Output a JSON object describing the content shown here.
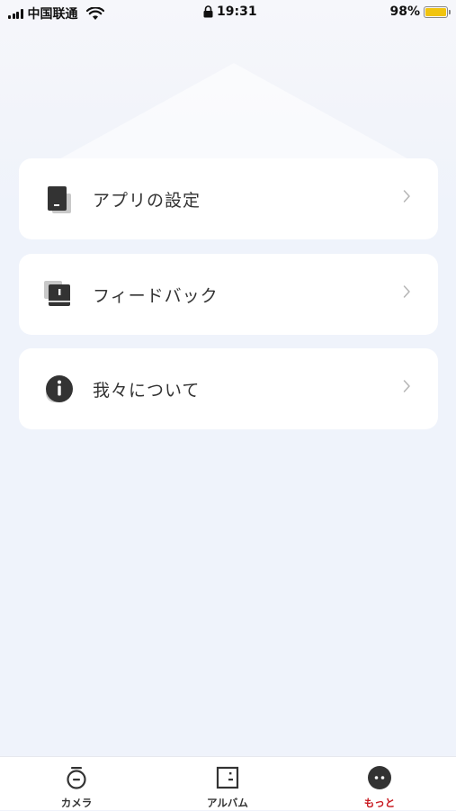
{
  "status_bar": {
    "carrier": "中国联通",
    "time": "19:31",
    "battery_percent": "98%",
    "battery_level": 0.98,
    "icons": [
      "signal-icon",
      "wifi-icon",
      "lock-icon",
      "battery-icon"
    ]
  },
  "menu": {
    "items": [
      {
        "label": "アプリの設定",
        "icon": "app-settings-icon",
        "chevron": "chevron-right-icon"
      },
      {
        "label": "フィードバック",
        "icon": "feedback-icon",
        "chevron": "chevron-right-icon"
      },
      {
        "label": "我々について",
        "icon": "info-icon",
        "chevron": "chevron-right-icon"
      }
    ]
  },
  "tab_bar": {
    "tabs": [
      {
        "label": "カメラ",
        "icon": "camera-icon",
        "active": false
      },
      {
        "label": "アルバム",
        "icon": "album-icon",
        "active": false
      },
      {
        "label": "もっと",
        "icon": "more-icon",
        "active": true
      }
    ],
    "active_color": "#c8181f",
    "inactive_color": "#333333"
  },
  "colors": {
    "background": "#eff3fb",
    "card": "#ffffff",
    "icon_dark": "#333333",
    "icon_shadow": "#c8c8c8",
    "chevron": "#b5b5b5",
    "battery_fill": "#f1c40f"
  }
}
